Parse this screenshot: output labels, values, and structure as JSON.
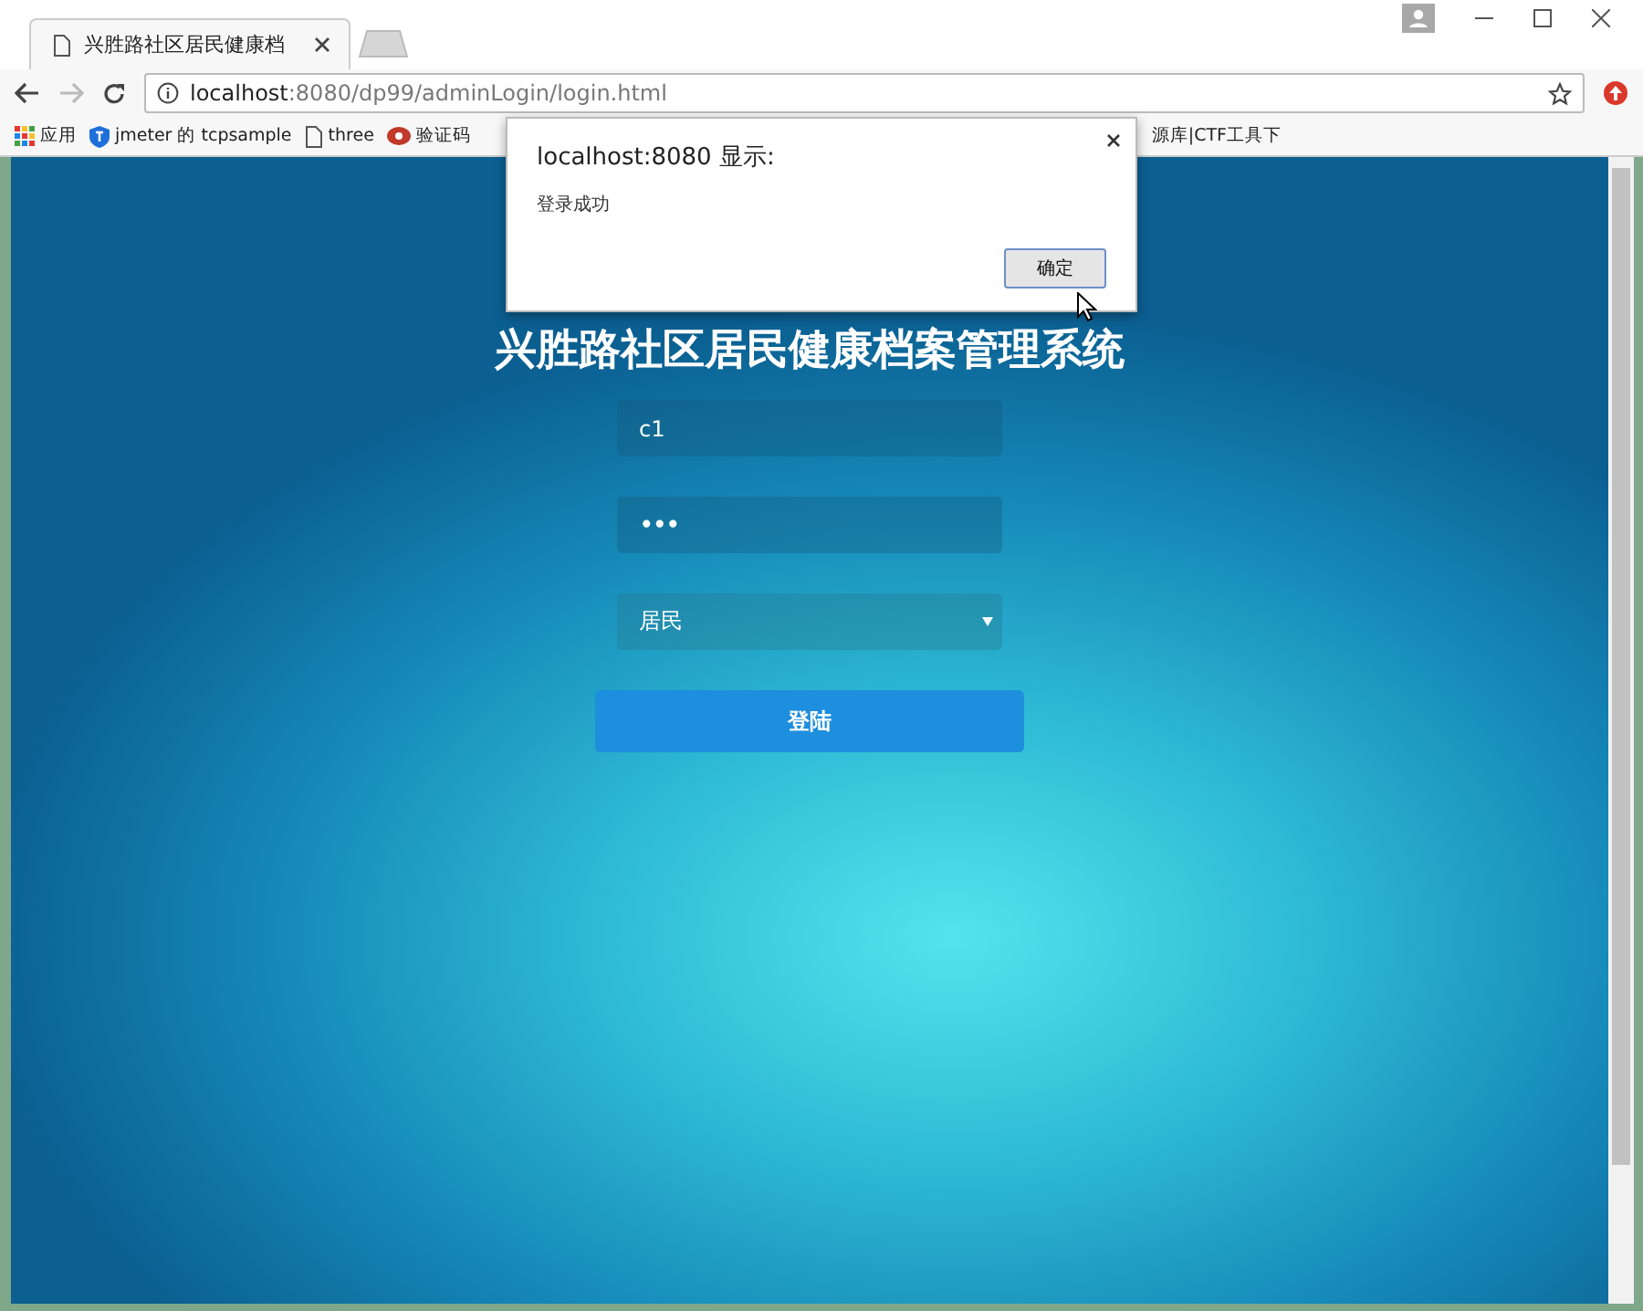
{
  "tabs": [
    {
      "title": "兴胜路社区居民健康档",
      "selected": true
    }
  ],
  "address_bar": {
    "host": "localhost",
    "path": ":8080/dp99/adminLogin/login.html"
  },
  "bookmarks": [
    {
      "label": "应用",
      "kind": "apps"
    },
    {
      "label": "jmeter 的 tcpsample",
      "kind": "shield"
    },
    {
      "label": "three",
      "kind": "page"
    },
    {
      "label": "验证码",
      "kind": "logo"
    },
    {
      "label": "源库|CTF工具下",
      "kind": "cut"
    }
  ],
  "page": {
    "title": "兴胜路社区居民健康档案管理系统",
    "username": "c1",
    "password": "•••",
    "role": "居民",
    "login_button": "登陆"
  },
  "dialog": {
    "title": "localhost:8080 显示:",
    "message": "登录成功",
    "ok_button": "确定"
  }
}
